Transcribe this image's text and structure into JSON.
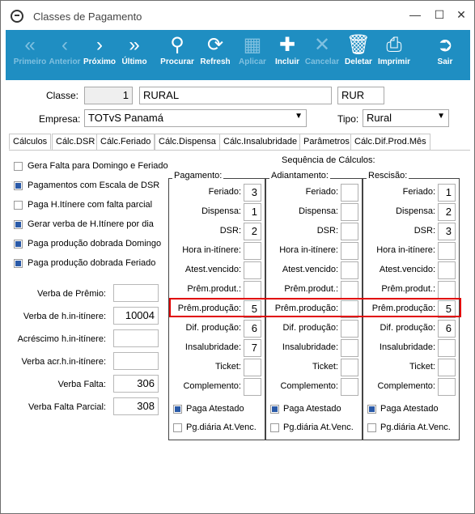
{
  "window": {
    "title": "Classes de Pagamento"
  },
  "toolbar": {
    "items": [
      {
        "label": "Primeiro",
        "icon": "first-icon",
        "enabled": false
      },
      {
        "label": "Anterior",
        "icon": "previous-icon",
        "enabled": false
      },
      {
        "label": "Próximo",
        "icon": "next-icon",
        "enabled": true
      },
      {
        "label": "Último",
        "icon": "last-icon",
        "enabled": true
      },
      {
        "label": "Procurar",
        "icon": "search-icon",
        "enabled": true
      },
      {
        "label": "Refresh",
        "icon": "refresh-icon",
        "enabled": true
      },
      {
        "label": "Aplicar",
        "icon": "save-icon",
        "enabled": false
      },
      {
        "label": "Incluir",
        "icon": "plus-icon",
        "enabled": true
      },
      {
        "label": "Cancelar",
        "icon": "close-icon",
        "enabled": false
      },
      {
        "label": "Deletar",
        "icon": "trash-icon",
        "enabled": true
      },
      {
        "label": "Imprimir",
        "icon": "print-icon",
        "enabled": true
      },
      {
        "label": "Sair",
        "icon": "exit-icon",
        "enabled": true
      }
    ]
  },
  "header": {
    "classe_label": "Classe:",
    "classe_num": "1",
    "classe_name": "RURAL",
    "classe_code": "RUR",
    "empresa_label": "Empresa:",
    "empresa_value": "TOTvS Panamá",
    "tipo_label": "Tipo:",
    "tipo_value": "Rural"
  },
  "tabs": [
    "Cálculos",
    "Cálc.DSR",
    "Cálc.Feriado",
    "Cálc.Dispensa",
    "Cálc.Insalubridade",
    "Parâmetros",
    "Cálc.Dif.Prod.Mês"
  ],
  "options": [
    {
      "label": "Gera Falta para Domingo e Feriado",
      "checked": false
    },
    {
      "label": "Pagamentos com Escala de DSR",
      "checked": true
    },
    {
      "label": "Paga H.Itínere com falta parcial",
      "checked": false
    },
    {
      "label": "Gerar verba de H.Itínere por dia",
      "checked": true
    },
    {
      "label": "Paga produção dobrada Domingo",
      "checked": true
    },
    {
      "label": "Paga produção dobrada Feriado",
      "checked": true
    }
  ],
  "verbas": [
    {
      "label": "Verba de Prêmio:",
      "value": ""
    },
    {
      "label": "Verba de h.in-itínere:",
      "value": "10004"
    },
    {
      "label": "Acréscimo h.in-itínere:",
      "value": ""
    },
    {
      "label": "Verba acr.h.in-itínere:",
      "value": ""
    },
    {
      "label": "Verba Falta:",
      "value": "306"
    },
    {
      "label": "Verba Falta Parcial:",
      "value": "308"
    }
  ],
  "sequencia_title": "Sequência de Cálculos:",
  "panels": [
    {
      "title": "Pagamento:",
      "rows": [
        {
          "label": "Feriado:",
          "value": "3"
        },
        {
          "label": "Dispensa:",
          "value": "1"
        },
        {
          "label": "DSR:",
          "value": "2"
        },
        {
          "label": "Hora in-itínere:",
          "value": ""
        },
        {
          "label": "Atest.vencido:",
          "value": ""
        },
        {
          "label": "Prêm.produt.:",
          "value": ""
        },
        {
          "label": "Prêm.produção:",
          "value": "5"
        },
        {
          "label": "Dif. produção:",
          "value": "6"
        },
        {
          "label": "Insalubridade:",
          "value": "7"
        },
        {
          "label": "Ticket:",
          "value": ""
        },
        {
          "label": "Complemento:",
          "value": ""
        }
      ],
      "paga_atestado": {
        "label": "Paga Atestado",
        "checked": true
      },
      "pg_diaria": {
        "label": "Pg.diária At.Venc.",
        "checked": false
      }
    },
    {
      "title": "Adiantamento:",
      "rows": [
        {
          "label": "Feriado:",
          "value": ""
        },
        {
          "label": "Dispensa:",
          "value": ""
        },
        {
          "label": "DSR:",
          "value": ""
        },
        {
          "label": "Hora in-itínere:",
          "value": ""
        },
        {
          "label": "Atest.vencido:",
          "value": ""
        },
        {
          "label": "Prêm.produt.:",
          "value": ""
        },
        {
          "label": "Prêm.produção:",
          "value": ""
        },
        {
          "label": "Dif. produção:",
          "value": ""
        },
        {
          "label": "Insalubridade:",
          "value": ""
        },
        {
          "label": "Ticket:",
          "value": ""
        },
        {
          "label": "Complemento:",
          "value": ""
        }
      ],
      "paga_atestado": {
        "label": "Paga Atestado",
        "checked": true
      },
      "pg_diaria": {
        "label": "Pg.diária At.Venc.",
        "checked": false
      }
    },
    {
      "title": "Rescisão:",
      "rows": [
        {
          "label": "Feriado:",
          "value": "1"
        },
        {
          "label": "Dispensa:",
          "value": "2"
        },
        {
          "label": "DSR:",
          "value": "3"
        },
        {
          "label": "Hora in-itínere:",
          "value": ""
        },
        {
          "label": "Atest.vencido:",
          "value": ""
        },
        {
          "label": "Prêm.produt.:",
          "value": ""
        },
        {
          "label": "Prêm.produção:",
          "value": "5"
        },
        {
          "label": "Dif. produção:",
          "value": "6"
        },
        {
          "label": "Insalubridade:",
          "value": ""
        },
        {
          "label": "Ticket:",
          "value": ""
        },
        {
          "label": "Complemento:",
          "value": ""
        }
      ],
      "paga_atestado": {
        "label": "Paga Atestado",
        "checked": true
      },
      "pg_diaria": {
        "label": "Pg.diária At.Venc.",
        "checked": false
      }
    }
  ],
  "colors": {
    "toolbar": "#1f8ec2",
    "highlight": "#e00000",
    "checked": "#2a5aa8"
  }
}
